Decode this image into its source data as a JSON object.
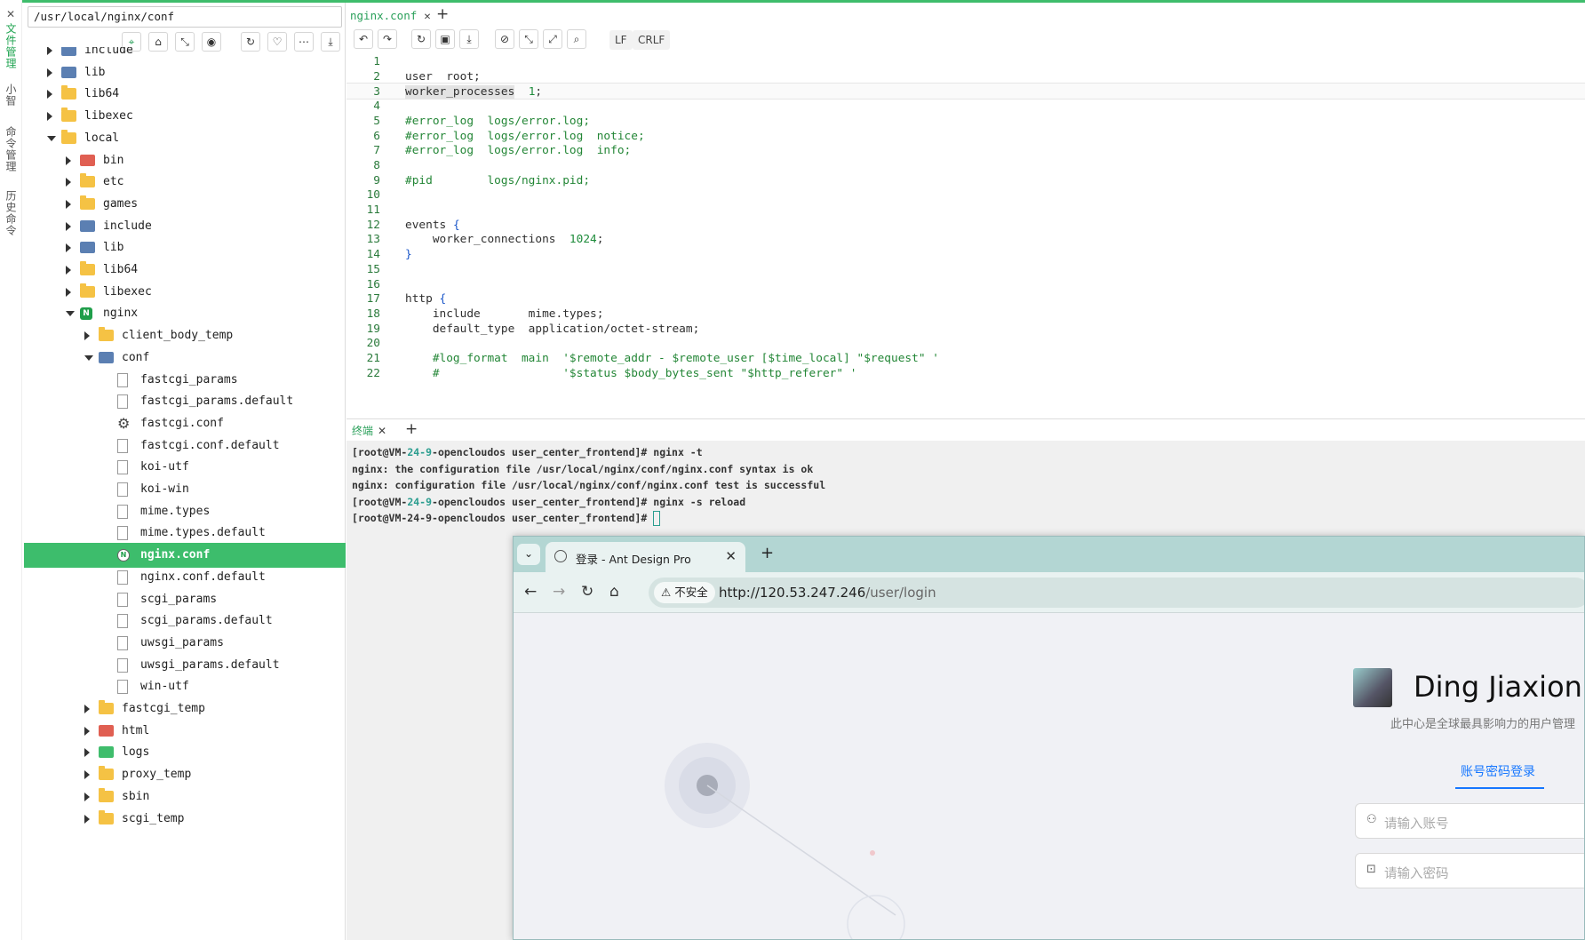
{
  "side_tabs": [
    "文件管理",
    "小智",
    "命令管理",
    "历史命令"
  ],
  "file_panel": {
    "path": "/usr/local/nginx/conf",
    "toolbar_icons": [
      "locate-icon",
      "home-icon",
      "collapse-icon",
      "eye-icon",
      "refresh-icon",
      "heart-icon",
      "more-icon",
      "upload-icon"
    ],
    "tree": [
      {
        "label": "include",
        "depth": 1,
        "kind": "lnk",
        "state": "closed"
      },
      {
        "label": "lib",
        "depth": 1,
        "kind": "lnk",
        "state": "closed"
      },
      {
        "label": "lib64",
        "depth": 1,
        "kind": "folder",
        "state": "closed"
      },
      {
        "label": "libexec",
        "depth": 1,
        "kind": "folder",
        "state": "closed"
      },
      {
        "label": "local",
        "depth": 1,
        "kind": "folder",
        "state": "open"
      },
      {
        "label": "bin",
        "depth": 2,
        "kind": "red",
        "state": "closed"
      },
      {
        "label": "etc",
        "depth": 2,
        "kind": "folder",
        "state": "closed"
      },
      {
        "label": "games",
        "depth": 2,
        "kind": "folder",
        "state": "closed"
      },
      {
        "label": "include",
        "depth": 2,
        "kind": "lnk",
        "state": "closed"
      },
      {
        "label": "lib",
        "depth": 2,
        "kind": "lnk",
        "state": "closed"
      },
      {
        "label": "lib64",
        "depth": 2,
        "kind": "folder",
        "state": "closed"
      },
      {
        "label": "libexec",
        "depth": 2,
        "kind": "folder",
        "state": "closed"
      },
      {
        "label": "nginx",
        "depth": 2,
        "kind": "nginx",
        "state": "open"
      },
      {
        "label": "client_body_temp",
        "depth": 3,
        "kind": "folder",
        "state": "closed"
      },
      {
        "label": "conf",
        "depth": 3,
        "kind": "lnk",
        "state": "open"
      },
      {
        "label": "fastcgi_params",
        "depth": 4,
        "kind": "doc",
        "state": "none"
      },
      {
        "label": "fastcgi_params.default",
        "depth": 4,
        "kind": "doc",
        "state": "none"
      },
      {
        "label": "fastcgi.conf",
        "depth": 4,
        "kind": "gear",
        "state": "none"
      },
      {
        "label": "fastcgi.conf.default",
        "depth": 4,
        "kind": "doc",
        "state": "none"
      },
      {
        "label": "koi-utf",
        "depth": 4,
        "kind": "doc",
        "state": "none"
      },
      {
        "label": "koi-win",
        "depth": 4,
        "kind": "doc",
        "state": "none"
      },
      {
        "label": "mime.types",
        "depth": 4,
        "kind": "doc",
        "state": "none"
      },
      {
        "label": "mime.types.default",
        "depth": 4,
        "kind": "doc",
        "state": "none"
      },
      {
        "label": "nginx.conf",
        "depth": 4,
        "kind": "nfile",
        "state": "none",
        "selected": true
      },
      {
        "label": "nginx.conf.default",
        "depth": 4,
        "kind": "doc",
        "state": "none"
      },
      {
        "label": "scgi_params",
        "depth": 4,
        "kind": "doc",
        "state": "none"
      },
      {
        "label": "scgi_params.default",
        "depth": 4,
        "kind": "doc",
        "state": "none"
      },
      {
        "label": "uwsgi_params",
        "depth": 4,
        "kind": "doc",
        "state": "none"
      },
      {
        "label": "uwsgi_params.default",
        "depth": 4,
        "kind": "doc",
        "state": "none"
      },
      {
        "label": "win-utf",
        "depth": 4,
        "kind": "doc",
        "state": "none"
      },
      {
        "label": "fastcgi_temp",
        "depth": 3,
        "kind": "folder",
        "state": "closed"
      },
      {
        "label": "html",
        "depth": 3,
        "kind": "red",
        "state": "closed"
      },
      {
        "label": "logs",
        "depth": 3,
        "kind": "green",
        "state": "closed"
      },
      {
        "label": "proxy_temp",
        "depth": 3,
        "kind": "folder",
        "state": "closed"
      },
      {
        "label": "sbin",
        "depth": 3,
        "kind": "folder",
        "state": "closed"
      },
      {
        "label": "scgi_temp",
        "depth": 3,
        "kind": "folder",
        "state": "closed"
      }
    ]
  },
  "editor": {
    "tab_label": "nginx.conf",
    "close_glyph": "✕",
    "plus_glyph": "+",
    "toolbar_icons": [
      "undo-icon",
      "redo-icon",
      "reload-icon",
      "save-icon",
      "download-icon",
      "compass-icon",
      "collapse-icon",
      "expand-icon",
      "search-icon"
    ],
    "eol_options": [
      "LF",
      "CRLF"
    ],
    "current_line": 3,
    "lines": [
      "",
      "user  root;",
      "worker_processes  1;",
      "",
      "#error_log  logs/error.log;",
      "#error_log  logs/error.log  notice;",
      "#error_log  logs/error.log  info;",
      "",
      "#pid        logs/nginx.pid;",
      "",
      "",
      "events {",
      "    worker_connections  1024;",
      "}",
      "",
      "",
      "http {",
      "    include       mime.types;",
      "    default_type  application/octet-stream;",
      "",
      "    #log_format  main  '$remote_addr - $remote_user [$time_local] \"$request\" '",
      "    #                  '$status $body_bytes_sent \"$http_referer\" '"
    ]
  },
  "terminal": {
    "tab_label": "终端",
    "lines": [
      {
        "prompt_user": "[root@VM-",
        "prompt_num": "24-9",
        "prompt_rest": "-opencloudos user_center_frontend]# ",
        "text": "nginx -t"
      },
      {
        "text": "nginx: the configuration file /usr/local/nginx/conf/nginx.conf syntax is ok"
      },
      {
        "text": "nginx: configuration file /usr/local/nginx/conf/nginx.conf test is successful"
      },
      {
        "prompt_user": "[root@VM-",
        "prompt_num": "24-9",
        "prompt_rest": "-opencloudos user_center_frontend]# ",
        "text": "nginx -s reload"
      },
      {
        "prompt_user": "[root@VM-24-9-opencloudos user_center_frontend]# ",
        "text": "",
        "cursor": true
      }
    ]
  },
  "browser": {
    "tab_title": "登录 - Ant Design Pro",
    "secure_label": "不安全",
    "url_host": "http://120.53.247.246",
    "url_path": "/user/login",
    "brand_title": "Ding Jiaxion",
    "slogan": "此中心是全球最具影响力的用户管理",
    "login_tab": "账号密码登录",
    "username_placeholder": "请输入账号",
    "password_placeholder": "请输入密码",
    "accent": "#1677ff"
  },
  "colors": {
    "brand_green": "#3dbd6c",
    "line_number": "#2a7a3b"
  }
}
